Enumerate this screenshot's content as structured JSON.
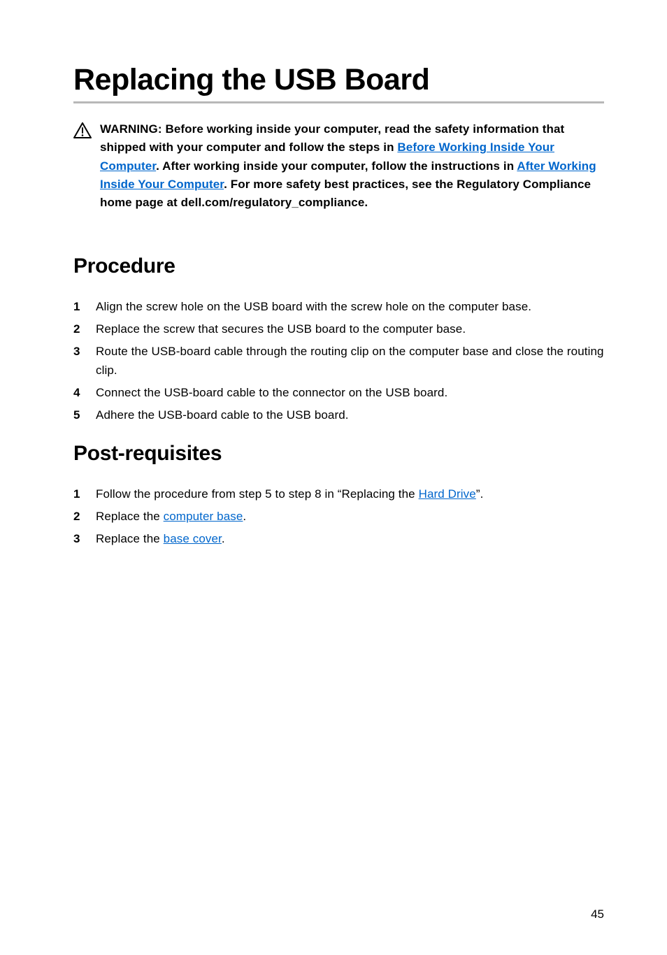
{
  "page": {
    "title": "Replacing the USB Board",
    "number": "45"
  },
  "warning": {
    "seg1": "WARNING: Before working inside your computer, read the safety information that shipped with your computer and follow the steps in ",
    "link1": "Before Working Inside Your Computer",
    "seg2": ". After working inside your computer, follow the instructions in ",
    "link2": "After Working Inside Your Computer",
    "seg3": ". For more safety best practices, see the Regulatory Compliance home page at dell.com/regulatory_compliance."
  },
  "sections": {
    "procedure": {
      "heading": "Procedure",
      "steps": [
        "Align the screw hole on the USB board with the screw hole on the computer base.",
        "Replace the screw that secures the USB board to the computer base.",
        "Route the USB-board cable through the routing clip on the computer base and close the routing clip.",
        "Connect the USB-board cable to the connector on the USB board.",
        "Adhere the USB-board cable to the USB board."
      ]
    },
    "postrequisites": {
      "heading": "Post-requisites",
      "steps": [
        {
          "seg1": "Follow the procedure from step 5 to step 8 in “Replacing the ",
          "link": "Hard Drive",
          "seg2": "”."
        },
        {
          "seg1": "Replace the ",
          "link": "computer base",
          "seg2": "."
        },
        {
          "seg1": "Replace the ",
          "link": "base cover",
          "seg2": "."
        }
      ]
    }
  }
}
